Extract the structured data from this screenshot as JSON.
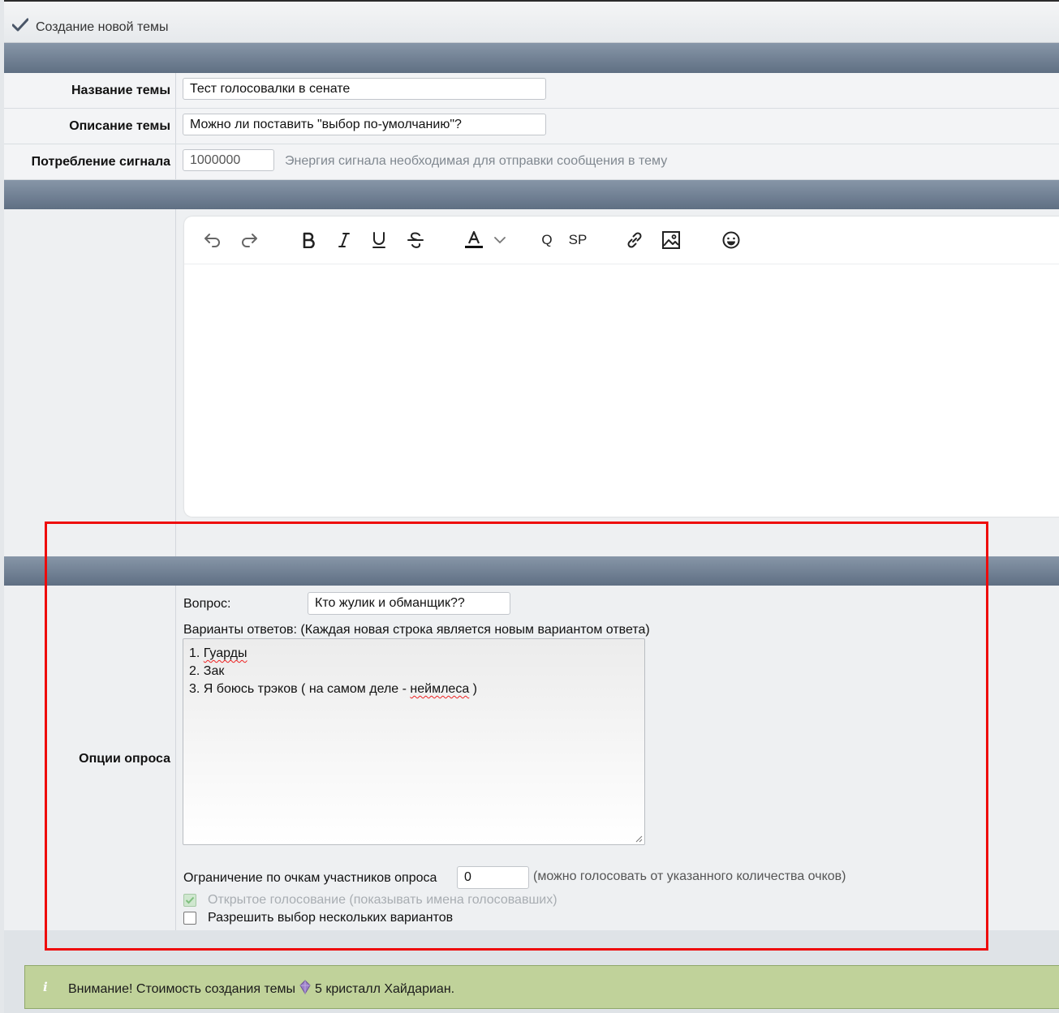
{
  "titlebar": {
    "title": "Создание новой темы",
    "icon": "check-icon"
  },
  "fields": {
    "topic_name": {
      "label": "Название темы",
      "value": "Тест голосовалки в сенате"
    },
    "topic_description": {
      "label": "Описание темы",
      "value": "Можно ли поставить \"выбор по-умолчанию\"?"
    },
    "signal": {
      "label": "Потребление сигнала",
      "value": "1000000",
      "hint": "Энергия сигнала необходимая для отправки сообщения в тему"
    }
  },
  "editor": {
    "toolbar": [
      {
        "name": "undo-icon"
      },
      {
        "name": "redo-icon"
      },
      {
        "name": "bold-icon"
      },
      {
        "name": "italic-icon"
      },
      {
        "name": "underline-icon"
      },
      {
        "name": "strikethrough-icon"
      },
      {
        "name": "text-color-icon"
      },
      {
        "name": "chevron-down-icon"
      },
      {
        "name": "quote-button",
        "label": "Q"
      },
      {
        "name": "spoiler-button",
        "label": "SP"
      },
      {
        "name": "link-icon"
      },
      {
        "name": "image-icon"
      },
      {
        "name": "emoji-icon"
      }
    ],
    "body": ""
  },
  "poll": {
    "section_label": "Опции опроса",
    "question_label": "Вопрос:",
    "question_value": "Кто жулик и обманщик??",
    "answers_label": "Варианты ответов: (Каждая новая строка является новым вариантом ответа)",
    "answers": [
      "1. Гуарды",
      "2. Зак",
      "3. Я боюсь трэков ( на самом деле - неймлеса )"
    ],
    "points_label": "Ограничение по очкам участников опроса",
    "points_value": "0",
    "points_hint": "(можно голосовать от указанного количества очков)",
    "open_vote_label": "Открытое голосование (показывать имена голосовавших)",
    "open_vote_checked": true,
    "multi_label": "Разрешить выбор нескольких вариантов",
    "multi_checked": false
  },
  "notice": {
    "icon": "info-icon",
    "text_before": "Внимание! Стоимость создания темы",
    "text_after": "5 кристалл Хайдариан."
  },
  "colors": {
    "highlight": "#ee0b0b",
    "notice_bg": "#c0d29a",
    "band": "#6d7d90"
  }
}
